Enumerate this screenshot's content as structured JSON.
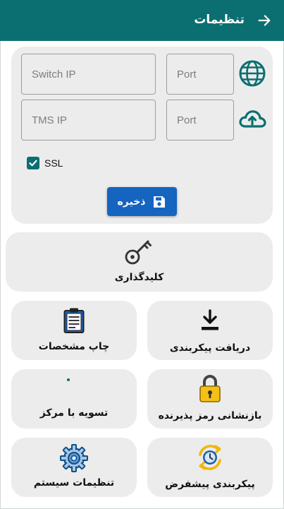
{
  "header": {
    "title": "تنظیمات"
  },
  "network": {
    "switch_ip_placeholder": "Switch IP",
    "tms_ip_placeholder": "TMS IP",
    "port_placeholder": "Port",
    "ssl_label": "SSL",
    "ssl_checked": true,
    "save_label": "ذخیره"
  },
  "tiles": {
    "key_injection": "کلیدگذاری",
    "download_config": "دریافت پیکربندی",
    "print_specs": "چاپ مشخصات",
    "reset_merchant_password": "بازنشانی رمز پذیرنده",
    "settle_with_center": "تسویه با مرکز",
    "default_config": "پیکربندی پیشفرض",
    "system_settings": "تنظیمات سیستم"
  },
  "colors": {
    "primary": "#0b6f72",
    "button": "#1565c0",
    "tile_bg": "#ececec"
  }
}
